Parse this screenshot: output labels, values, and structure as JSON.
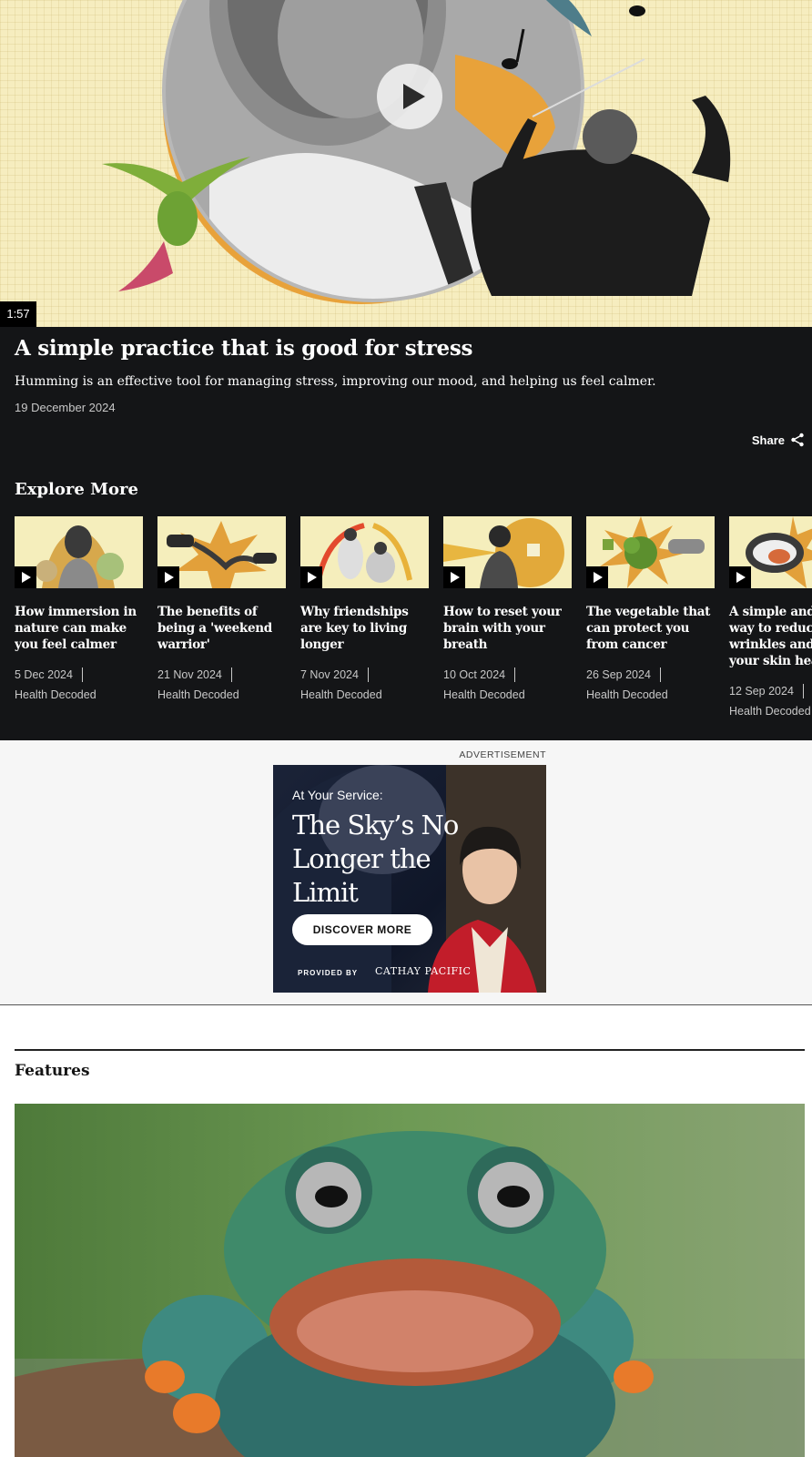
{
  "video": {
    "duration": "1:57",
    "title": "A simple practice that is good for stress",
    "description": "Humming is an effective tool for managing stress, improving our mood, and helping us feel calmer.",
    "date": "19 December 2024",
    "share_label": "Share"
  },
  "explore": {
    "title": "Explore More",
    "cards": [
      {
        "title": "How immersion in nature can make you feel calmer",
        "date": "5 Dec 2024",
        "category": "Health Decoded"
      },
      {
        "title": "The benefits of being a 'weekend warrior'",
        "date": "21 Nov 2024",
        "category": "Health Decoded"
      },
      {
        "title": "Why friendships are key to living longer",
        "date": "7 Nov 2024",
        "category": "Health Decoded"
      },
      {
        "title": "How to reset your brain with your breath",
        "date": "10 Oct 2024",
        "category": "Health Decoded"
      },
      {
        "title": "The vegetable that can protect you from cancer",
        "date": "26 Sep 2024",
        "category": "Health Decoded"
      },
      {
        "title": "A simple and easy way to reduce wrinkles and keep your skin healthy",
        "date": "12 Sep 2024",
        "category": "Health Decoded"
      }
    ]
  },
  "ad": {
    "label": "ADVERTISEMENT",
    "eyebrow": "At Your Service:",
    "headline": "The Sky’s No Longer the Limit",
    "cta": "DISCOVER MORE",
    "provided_by": "PROVIDED BY",
    "brand": "CATHAY PACIFIC"
  },
  "features": {
    "title": "Features"
  },
  "colors": {
    "dark_bg": "#141517",
    "hero_bg": "#f6edbf",
    "accent_orange": "#e8a23a"
  }
}
